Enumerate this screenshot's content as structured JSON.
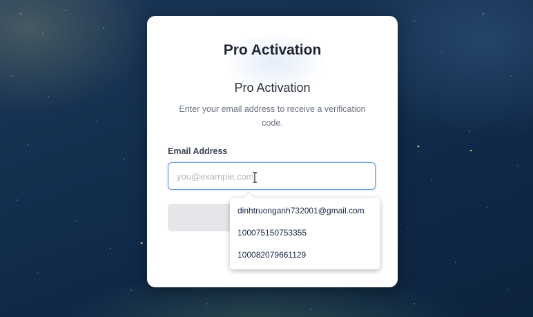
{
  "card": {
    "brand_title": "Pro Activation",
    "heading": "Pro Activation",
    "description": "Enter your email address to receive a verification code."
  },
  "form": {
    "email_label": "Email Address",
    "email_value": "",
    "email_placeholder": "you@example.com"
  },
  "autocomplete": {
    "suggestions": [
      "dinhtruonganh732001@gmail.com",
      "100075150753355",
      "100082079661129"
    ]
  },
  "colors": {
    "accent": "#5b93d6",
    "button_disabled": "#e4e6e9",
    "background": "#14304f"
  }
}
